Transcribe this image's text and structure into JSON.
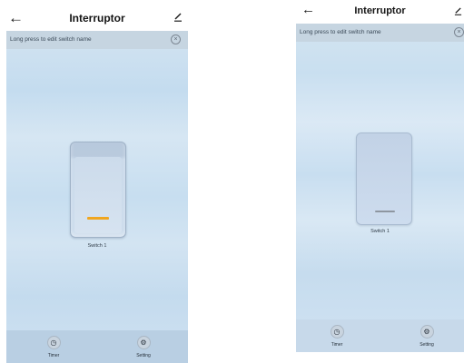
{
  "screens": [
    {
      "header": {
        "title": "Interruptor",
        "back_glyph": "←",
        "edit_icon": "pencil-icon"
      },
      "hint": {
        "text": "Long press to edit switch name",
        "close_glyph": "×"
      },
      "switch": {
        "label": "Switch 1",
        "state": "on",
        "indicator_color": "#f0a61f"
      },
      "toolbar": {
        "timer": {
          "label": "Timer",
          "icon": "clock-icon",
          "glyph": "◷"
        },
        "setting": {
          "label": "Setting",
          "icon": "gear-icon",
          "glyph": "⚙"
        }
      }
    },
    {
      "header": {
        "title": "Interruptor",
        "back_glyph": "←",
        "edit_icon": "pencil-icon"
      },
      "hint": {
        "text": "Long press to edit switch name",
        "close_glyph": "×"
      },
      "switch": {
        "label": "Switch 1",
        "state": "off",
        "indicator_color": "#8e96a0"
      },
      "toolbar": {
        "timer": {
          "label": "Timer",
          "icon": "clock-icon",
          "glyph": "◷"
        },
        "setting": {
          "label": "Setting",
          "icon": "gear-icon",
          "glyph": "⚙"
        }
      }
    }
  ]
}
